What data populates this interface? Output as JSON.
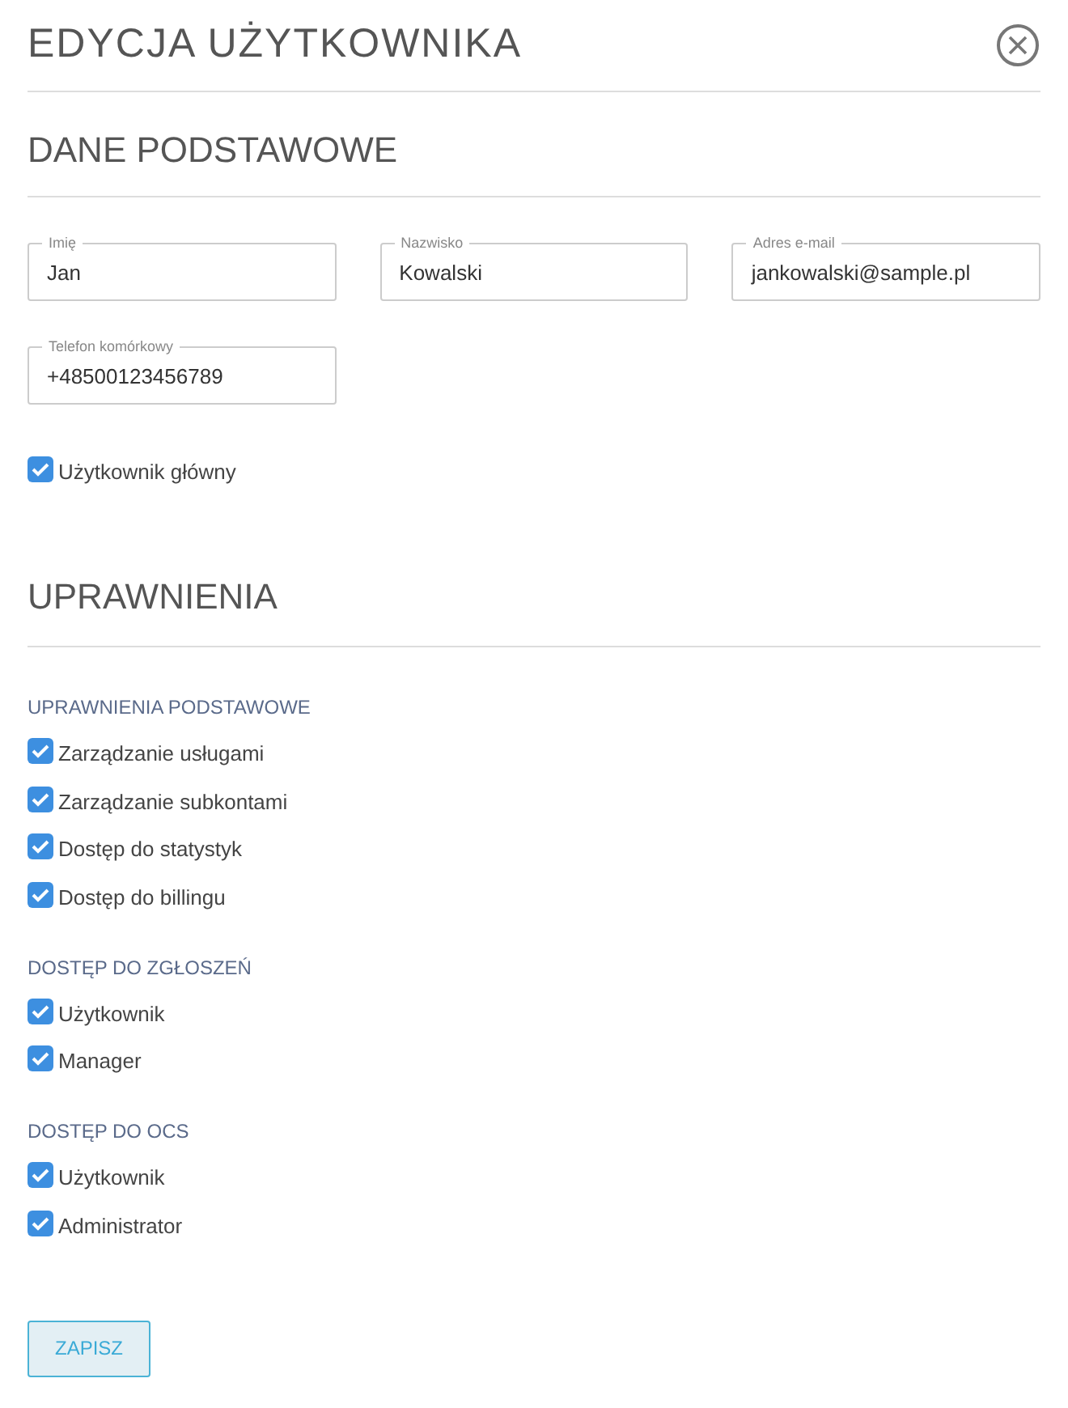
{
  "title": "EDYCJA UŻYTKOWNIKA",
  "basic": {
    "heading": "DANE PODSTAWOWE",
    "fields": [
      {
        "label": "Imię",
        "value": "Jan"
      },
      {
        "label": "Nazwisko",
        "value": "Kowalski"
      },
      {
        "label": "Adres e-mail",
        "value": "jankowalski@sample.pl"
      },
      {
        "label": "Telefon komórkowy",
        "value": "+48500123456789"
      }
    ],
    "main_user": {
      "label": "Użytkownik główny",
      "checked": true
    }
  },
  "permissions": {
    "heading": "UPRAWNIENIA",
    "groups": [
      {
        "title": "UPRAWNIENIA PODSTAWOWE",
        "items": [
          {
            "label": "Zarządzanie usługami",
            "checked": true
          },
          {
            "label": "Zarządzanie subkontami",
            "checked": true
          },
          {
            "label": "Dostęp do statystyk",
            "checked": true
          },
          {
            "label": "Dostęp do billingu",
            "checked": true
          }
        ]
      },
      {
        "title": "DOSTĘP DO ZGŁOSZEŃ",
        "items": [
          {
            "label": "Użytkownik",
            "checked": true
          },
          {
            "label": "Manager",
            "checked": true
          }
        ]
      },
      {
        "title": "DOSTĘP DO OCS",
        "items": [
          {
            "label": "Użytkownik",
            "checked": true
          },
          {
            "label": "Administrator",
            "checked": true
          }
        ]
      }
    ]
  },
  "save_button": "ZAPISZ"
}
